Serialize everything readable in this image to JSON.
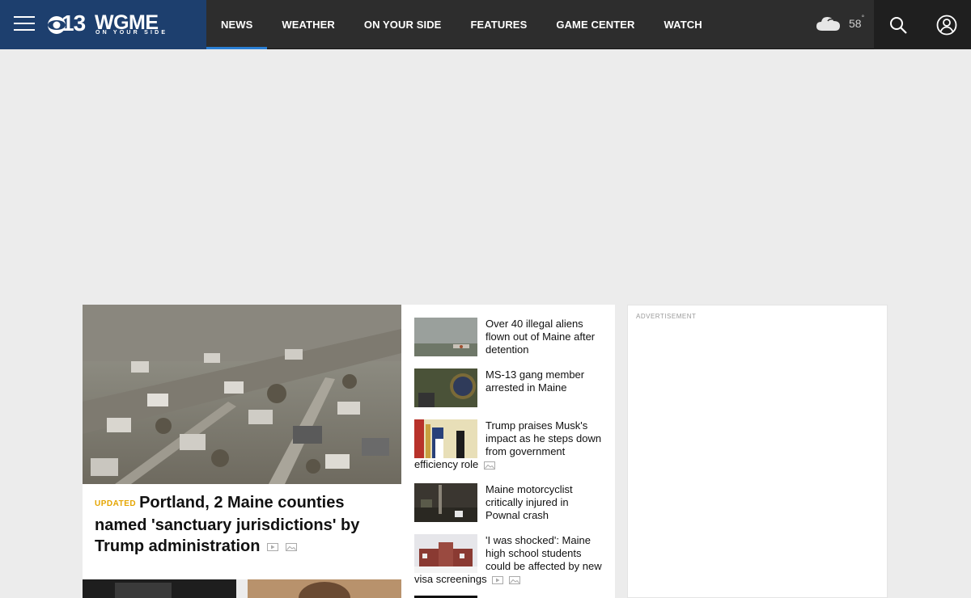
{
  "header": {
    "logo_main": "WGME",
    "logo_number": "13",
    "logo_tagline": "ON YOUR SIDE",
    "menu_icon": "hamburger-menu-icon",
    "brand_color": "#1d3f6e",
    "nav": [
      {
        "label": "NEWS",
        "active": true
      },
      {
        "label": "WEATHER"
      },
      {
        "label": "ON YOUR SIDE"
      },
      {
        "label": "FEATURES"
      },
      {
        "label": "GAME CENTER"
      },
      {
        "label": "WATCH"
      }
    ],
    "weather": {
      "icon": "cloudy-icon",
      "temp": "58",
      "degree": "°"
    },
    "search_icon": "search-icon",
    "account_icon": "user-account-icon"
  },
  "hero": {
    "badge": "UPDATED",
    "headline": "Portland, 2 Maine counties named 'sanctuary jurisdictions' by Trump administration",
    "media_icons": [
      "video-icon",
      "gallery-icon"
    ]
  },
  "stories": [
    {
      "title": "Over 40 illegal aliens flown out of Maine after detention"
    },
    {
      "title": "MS-13 gang member arrested in Maine"
    },
    {
      "title": "Trump praises Musk's impact as he steps down from government efficiency role",
      "media_icons": [
        "gallery-icon"
      ]
    },
    {
      "title": "Maine motorcyclist critically injured in Pownal crash"
    },
    {
      "title": "'I was shocked': Maine high school students could be affected by new visa screenings",
      "media_icons": [
        "video-icon",
        "gallery-icon"
      ]
    }
  ],
  "ad": {
    "label": "ADVERTISEMENT"
  },
  "colors": {
    "accent": "#2a7fd4",
    "updated": "#e5a500",
    "page_bg": "#ececec"
  }
}
